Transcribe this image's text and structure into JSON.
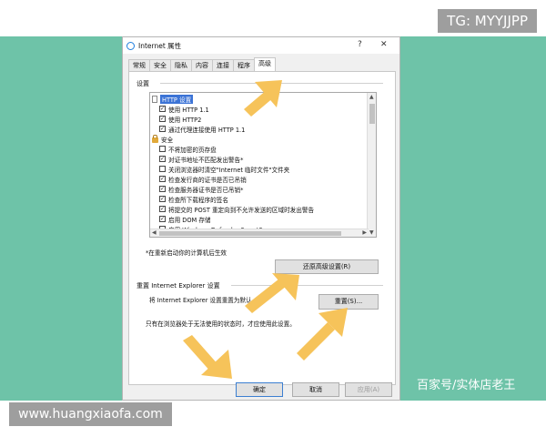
{
  "watermarks": {
    "top_right": "TG: MYYJJPP",
    "bottom_left": "www.huangxiaofa.com",
    "bottom_right": "百家号/实体店老王"
  },
  "dialog": {
    "title": "Internet 属性",
    "help_glyph": "?",
    "close_glyph": "✕"
  },
  "tabs": [
    "常规",
    "安全",
    "隐私",
    "内容",
    "连接",
    "程序",
    "高级"
  ],
  "active_tab": "高级",
  "settings": {
    "group_label": "设置",
    "items": [
      {
        "kind": "category",
        "label": "HTTP 设置",
        "selected": true
      },
      {
        "kind": "checkbox",
        "label": "使用 HTTP 1.1",
        "checked": true
      },
      {
        "kind": "checkbox",
        "label": "使用 HTTP2",
        "checked": true
      },
      {
        "kind": "checkbox",
        "label": "通过代理连接使用 HTTP 1.1",
        "checked": true
      },
      {
        "kind": "category",
        "label": "安全",
        "selected": false
      },
      {
        "kind": "checkbox",
        "label": "不将加密的页存盘",
        "checked": false
      },
      {
        "kind": "checkbox",
        "label": "对证书地址不匹配发出警告*",
        "checked": true
      },
      {
        "kind": "checkbox",
        "label": "关闭浏览器时清空\"Internet 临时文件\"文件夹",
        "checked": false
      },
      {
        "kind": "checkbox",
        "label": "检查发行商的证书是否已吊销",
        "checked": true
      },
      {
        "kind": "checkbox",
        "label": "检查服务器证书是否已吊销*",
        "checked": true
      },
      {
        "kind": "checkbox",
        "label": "检查所下载程序的签名",
        "checked": true
      },
      {
        "kind": "checkbox",
        "label": "将提交的 POST 重定向到不允许发送的区域时发出警告",
        "checked": true
      },
      {
        "kind": "checkbox",
        "label": "启用 DOM 存储",
        "checked": true
      },
      {
        "kind": "checkbox",
        "label": "启用 Windows Defender SmartScreen",
        "checked": false
      }
    ],
    "restart_note": "*在重新启动你的计算机后生效",
    "restore_button": "还原高级设置(R)"
  },
  "reset": {
    "group_label": "重置 Internet Explorer 设置",
    "description": "将 Internet Explorer 设置重置为默认",
    "button": "重置(S)...",
    "note": "只有在浏览器处于无法使用的状态时，才应使用此设置。"
  },
  "footer": {
    "ok": "确定",
    "cancel": "取消",
    "apply": "应用(A)"
  },
  "colors": {
    "background_teal": "#6ec3a8",
    "arrow_yellow": "#f6c35a",
    "selection_blue": "#3b73d6"
  }
}
